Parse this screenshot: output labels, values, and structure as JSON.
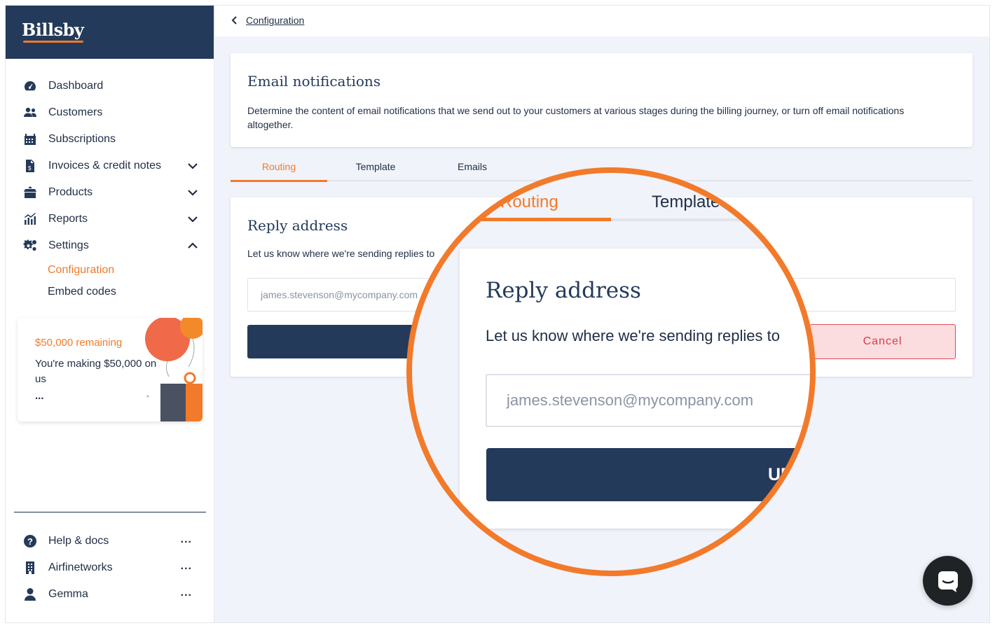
{
  "brand": {
    "name": "Billsby"
  },
  "sidebar": {
    "items": [
      {
        "label": "Dashboard",
        "icon": "dashboard-icon"
      },
      {
        "label": "Customers",
        "icon": "customers-icon"
      },
      {
        "label": "Subscriptions",
        "icon": "calendar-icon"
      },
      {
        "label": "Invoices & credit notes",
        "icon": "invoice-icon",
        "expandable": true
      },
      {
        "label": "Products",
        "icon": "products-icon",
        "expandable": true
      },
      {
        "label": "Reports",
        "icon": "reports-icon",
        "expandable": true
      },
      {
        "label": "Settings",
        "icon": "gears-icon",
        "expanded": true
      }
    ],
    "settings_sub": [
      {
        "label": "Configuration",
        "active": true
      },
      {
        "label": "Embed codes"
      }
    ],
    "promo": {
      "title": "$50,000 remaining",
      "text": "You're making $50,000 on us",
      "more": "..."
    },
    "footer": [
      {
        "label": "Help & docs",
        "icon": "help-icon",
        "dots": "..."
      },
      {
        "label": "Airfinetworks",
        "icon": "building-icon",
        "dots": "..."
      },
      {
        "label": "Gemma",
        "icon": "user-icon",
        "dots": "..."
      }
    ]
  },
  "topbar": {
    "back_label": "Configuration"
  },
  "header_card": {
    "title": "Email notifications",
    "description": "Determine the content of email notifications that we send out to your customers at various stages during the billing journey, or turn off email notifications altogether."
  },
  "tabs": [
    {
      "label": "Routing",
      "active": true
    },
    {
      "label": "Template"
    },
    {
      "label": "Emails"
    }
  ],
  "reply_card": {
    "title": "Reply address",
    "lead": "Let us know where we're sending replies to",
    "input_placeholder": "james.stevenson@mycompany.com",
    "update_label": "UPDATE",
    "cancel_label": "Cancel"
  },
  "magnifier": {
    "tab_active": "Routing",
    "tab_next": "Template",
    "title": "Reply address",
    "lead": "Let us know where we're sending replies to",
    "input_placeholder": "james.stevenson@mycompany.com",
    "button_partial": "UP"
  },
  "colors": {
    "navy": "#243a5a",
    "accent": "#f27a2a",
    "danger": "#d83a4c",
    "background": "#f0f3fa"
  }
}
